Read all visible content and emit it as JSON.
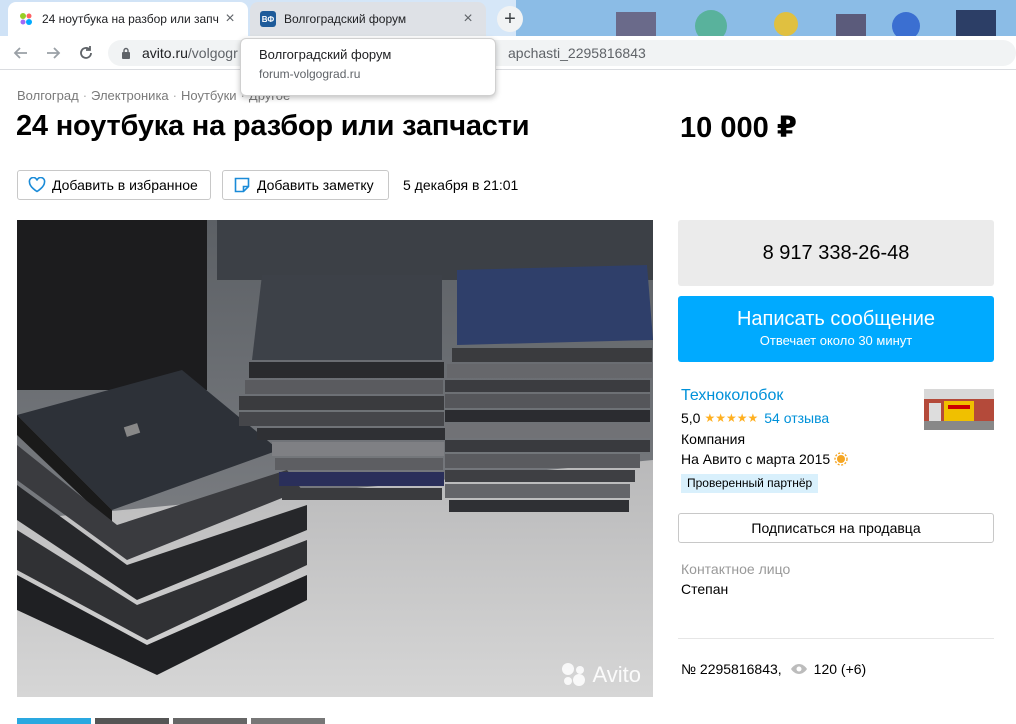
{
  "browser": {
    "tabs": [
      {
        "title": "24 ноутбука на разбор или запч",
        "active": true
      },
      {
        "title": "Волгоградский форум",
        "active": false,
        "favicon_text": "ВФ"
      }
    ],
    "url_host": "avito.ru",
    "url_path": "/volgogr",
    "url_tail": "apchasti_2295816843",
    "tooltip": {
      "title": "Волгоградский форум",
      "url": "forum-volgograd.ru"
    }
  },
  "listing": {
    "breadcrumbs": [
      "Волгоград",
      "Электроника",
      "Ноутбуки",
      "Другое"
    ],
    "title": "24 ноутбука на разбор или запчасти",
    "price": "10 000 ₽",
    "favorite_label": "Добавить в избранное",
    "note_label": "Добавить заметку",
    "date": "5 декабря в 21:01",
    "watermark": "Avito"
  },
  "contact": {
    "phone": "8 917 338-26-48",
    "message_label": "Написать сообщение",
    "message_sub": "Отвечает около 30 минут"
  },
  "seller": {
    "name": "Техноколобок",
    "rating": "5,0",
    "stars": "★★★★★",
    "reviews": "54 отзыва",
    "type": "Компания",
    "since": "На Авито с марта 2015",
    "badge": "Проверенный партнёр",
    "subscribe_label": "Подписаться на продавца",
    "contact_label": "Контактное лицо",
    "contact_name": "Степан"
  },
  "meta": {
    "item_number": "№ 2295816843,",
    "views": "120 (+6)"
  },
  "colors": {
    "accent": "#00aaff",
    "link": "#0091d9",
    "star": "#ffb021",
    "partner_bg": "#d9f0fc"
  }
}
